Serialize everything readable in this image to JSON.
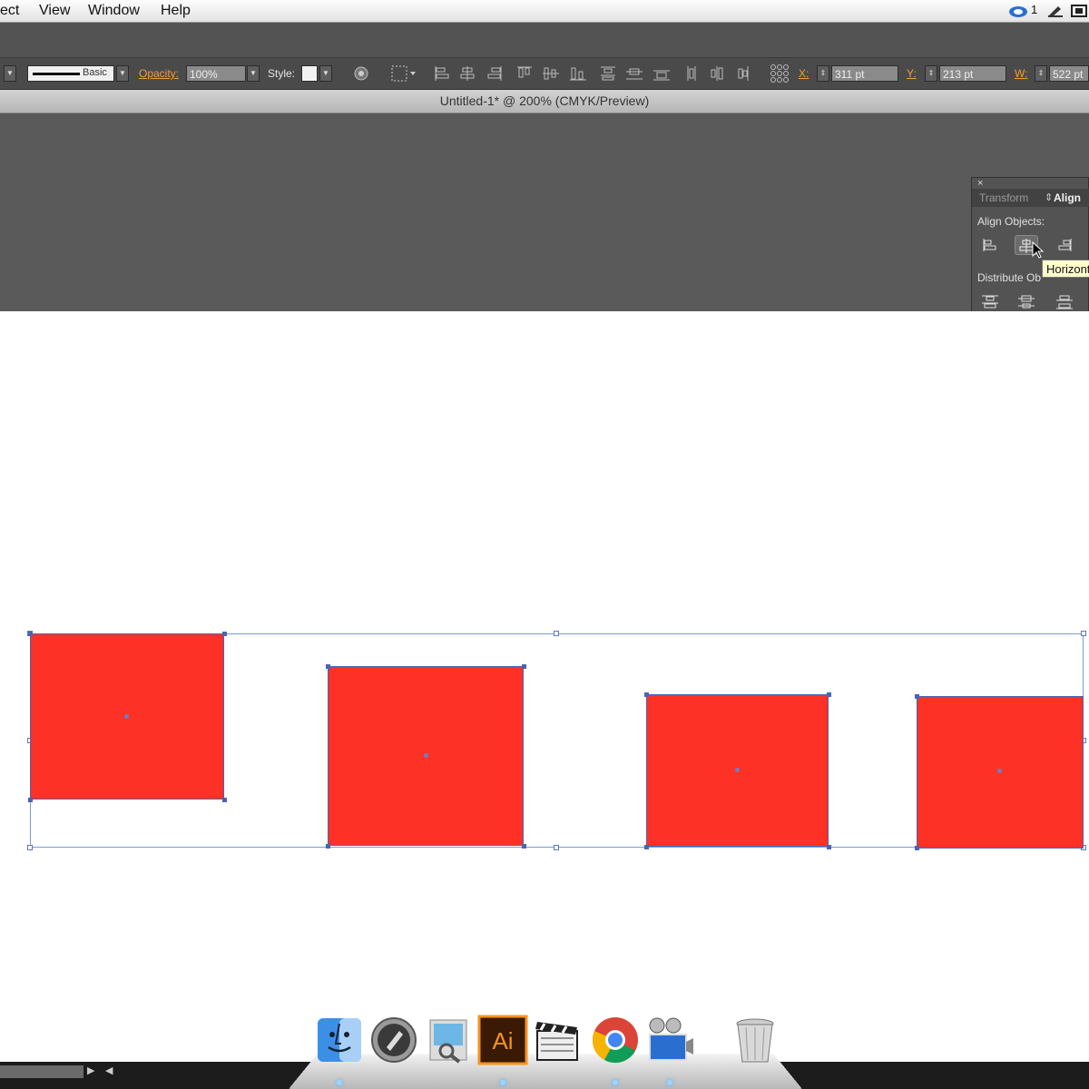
{
  "menu_bar": {
    "items": [
      "ect",
      "View",
      "Window",
      "Help"
    ],
    "status": {
      "cc_count": "1"
    }
  },
  "control_bar": {
    "stroke_profile": "Basic",
    "opacity_label": "Opacity:",
    "opacity_value": "100%",
    "style_label": "Style:",
    "x_label": "X:",
    "x_value": "311 pt",
    "y_label": "Y:",
    "y_value": "213 pt",
    "w_label": "W:",
    "w_value": "522 pt"
  },
  "document": {
    "title": "Untitled-1* @ 200% (CMYK/Preview)"
  },
  "align_panel": {
    "tabs": [
      {
        "label": "Transform",
        "active": false
      },
      {
        "label": "Align",
        "active": true
      }
    ],
    "align_objects_label": "Align Objects:",
    "distribute_objects_label": "Distribute Ob",
    "align_buttons": [
      "horizontal-align-left",
      "horizontal-align-center",
      "horizontal-align-right"
    ],
    "distribute_buttons": [
      "vertical-distribute-top",
      "vertical-distribute-center",
      "vertical-distribute-bottom"
    ],
    "tooltip": "Horizontal Align Center"
  },
  "artwork": {
    "fill_color": "#fe3126",
    "stroke_color": "#4a64b0",
    "object_count": 4
  },
  "dock": {
    "apps": [
      "finder-icon",
      "launchpad-icon",
      "preview-icon",
      "illustrator-icon",
      "final-cut-icon",
      "chrome-icon",
      "imovie-icon",
      "trash-icon"
    ],
    "illustrator_label": "Ai"
  }
}
